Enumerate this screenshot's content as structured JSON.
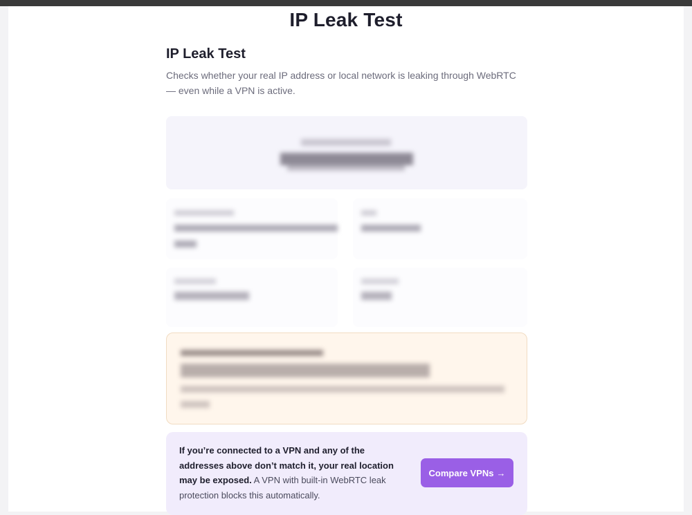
{
  "page": {
    "title": "IP Leak Test"
  },
  "section": {
    "title": "IP Leak Test",
    "description": "Checks whether your real IP address or local network is leaking through WebRTC — even while a VPN is active."
  },
  "cta": {
    "text_strong": "If you’re connected to a VPN and any of the addresses above don’t match it, your real location may be exposed.",
    "text_normal": " A VPN with built-in WebRTC leak protection blocks this automatically.",
    "button_label": "Compare VPNs",
    "button_icon": "arrow-right-icon",
    "button_color": "#9a5fe6"
  },
  "colors": {
    "accent": "#9a5fe6",
    "ip_card_bg": "#f5f4fb",
    "warning_bg": "#fff6ec",
    "cta_bg": "#f1ecfc"
  }
}
